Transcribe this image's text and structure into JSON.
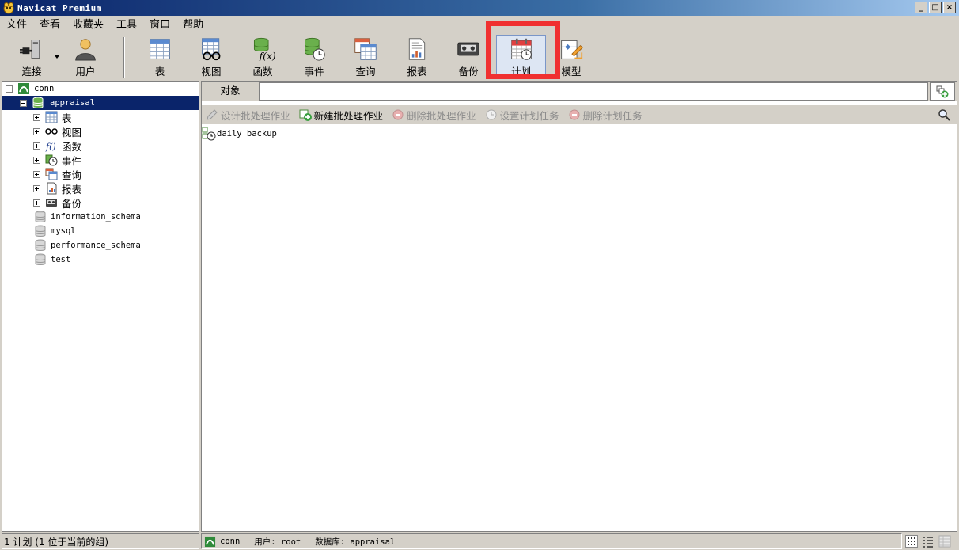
{
  "window": {
    "title": "Navicat Premium",
    "controls": {
      "minimize": "_",
      "maximize": "□",
      "close": "×"
    }
  },
  "menu": [
    "文件",
    "查看",
    "收藏夹",
    "工具",
    "窗口",
    "帮助"
  ],
  "toolbar": {
    "connect": "连接",
    "user": "用户",
    "table": "表",
    "view": "视图",
    "function": "函数",
    "event": "事件",
    "query": "查询",
    "report": "报表",
    "backup": "备份",
    "schedule": "计划",
    "model": "模型",
    "active": "schedule",
    "highlight_color": "#f03030"
  },
  "tree": {
    "connection": "conn",
    "database_selected": "appraisal",
    "objects": [
      "表",
      "视图",
      "函数",
      "事件",
      "查询",
      "报表",
      "备份"
    ],
    "other_databases": [
      "information_schema",
      "mysql",
      "performance_schema",
      "test"
    ]
  },
  "tabs": {
    "object": "对象"
  },
  "actions": {
    "design_batch": "设计批处理作业",
    "new_batch": "新建批处理作业",
    "delete_batch": "删除批处理作业",
    "set_schedule": "设置计划任务",
    "delete_schedule": "删除计划任务"
  },
  "items": [
    "daily backup"
  ],
  "status": {
    "left": "1 计划 (1 位于当前的组)",
    "connection": "conn",
    "user": "用户: root",
    "database": "数据库: appraisal"
  },
  "colors": {
    "selection": "#0a246a",
    "accent": "#3a6ea5"
  }
}
